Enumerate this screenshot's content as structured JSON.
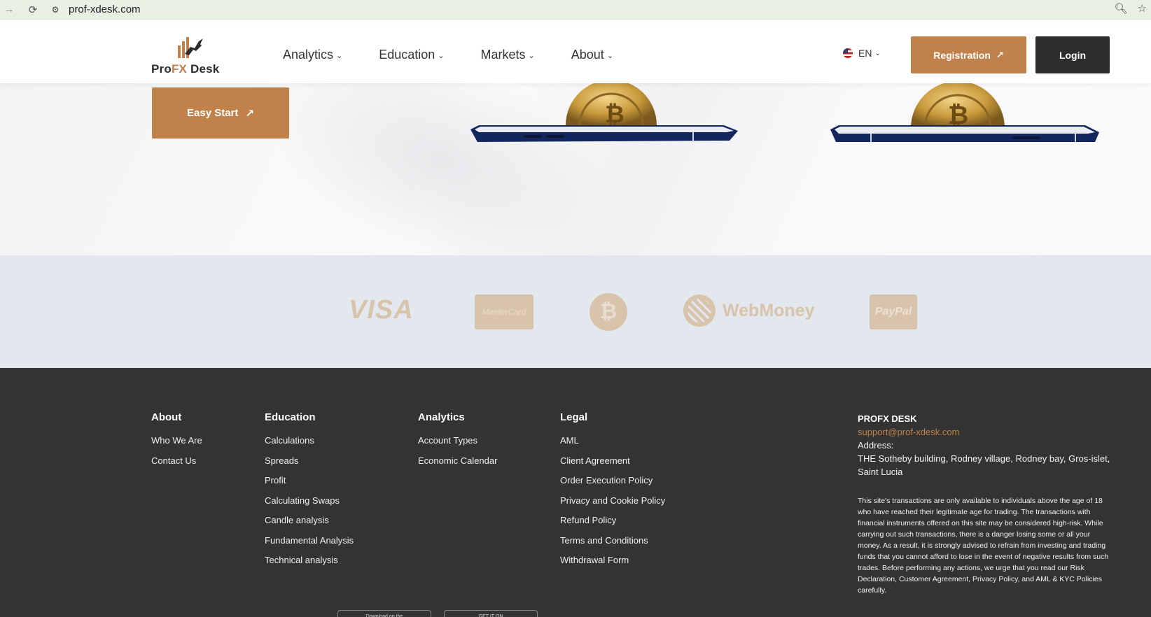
{
  "browser": {
    "url": "prof-xdesk.com"
  },
  "header": {
    "logo": {
      "prefix": "Pro",
      "fx": "FX",
      "suffix": " Desk"
    },
    "nav": [
      {
        "label": "Analytics"
      },
      {
        "label": "Education"
      },
      {
        "label": "Markets"
      },
      {
        "label": "About"
      }
    ],
    "language": "EN",
    "registration_label": "Registration",
    "login_label": "Login"
  },
  "hero": {
    "easy_start_label": "Easy Start"
  },
  "payments": {
    "visa": "VISA",
    "mastercard": "MasterCard",
    "bitcoin": "₿",
    "webmoney": "WebMoney",
    "paypal": "PayPal"
  },
  "footer": {
    "columns": [
      {
        "title": "About",
        "links": [
          "Who We Are",
          "Contact Us"
        ]
      },
      {
        "title": "Education",
        "links": [
          "Calculations",
          "Spreads",
          "Profit",
          "Calculating Swaps",
          "Candle analysis",
          "Fundamental Analysis",
          "Technical analysis"
        ]
      },
      {
        "title": "Analytics",
        "links": [
          "Account Types",
          "Economic Calendar"
        ]
      },
      {
        "title": "Legal",
        "links": [
          "AML",
          "Client Agreement",
          "Order Execution Policy",
          "Privacy and Cookie Policy",
          "Refund Policy",
          "Terms and Conditions",
          "Withdrawal Form"
        ]
      }
    ],
    "company": {
      "name": "PROFX DESK",
      "email": "support@prof-xdesk.com",
      "address_label": "Address:",
      "address": "THE Sotheby building, Rodney village, Rodney bay, Gros-islet, Saint Lucia",
      "disclaimer": "This site's transactions are only available to individuals above the age of 18 who have reached their legitimate age for trading. The transactions with financial instruments offered on this site may be considered high-risk. While carrying out such transactions, there is a danger losing some or all your money. As a result, it is strongly advised to refrain from investing and trading funds that you cannot afford to lose in the event of negative results from such trades. Before performing any actions, we urge that you read our Risk Declaration, Customer Agreement, Privacy Policy, and AML & KYC Policies carefully."
    },
    "store_badges": [
      "Download on the",
      "GET IT ON"
    ]
  },
  "colors": {
    "accent": "#c0824a",
    "dark": "#2d2d2d",
    "footer_bg": "#333333",
    "payments_bg": "#e3e7ee"
  }
}
